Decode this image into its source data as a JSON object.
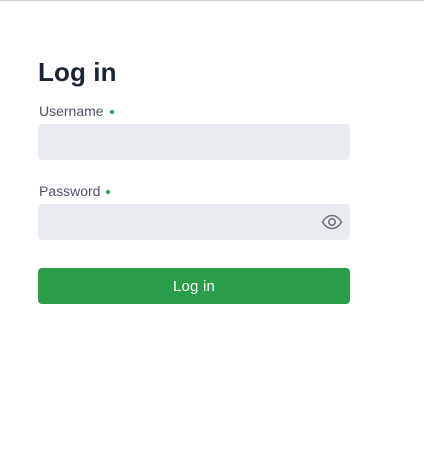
{
  "page": {
    "title": "Log in"
  },
  "form": {
    "username": {
      "label": "Username",
      "value": "",
      "required": true
    },
    "password": {
      "label": "Password",
      "value": "",
      "required": true,
      "toggle_icon": "eye-icon"
    },
    "submit_label": "Log in"
  },
  "colors": {
    "accent": "#2a9d4b",
    "input_background": "#e8ebef",
    "title_text": "#1a2535",
    "label_text": "#4b5563",
    "icon": "#6b7280"
  }
}
